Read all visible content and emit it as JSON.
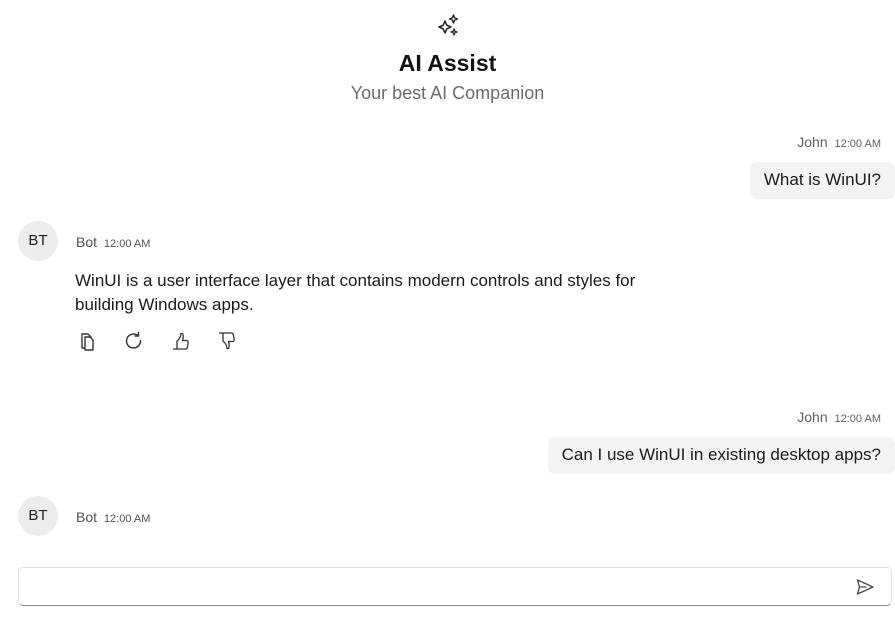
{
  "header": {
    "icon": "sparkle-icon",
    "title": "AI Assist",
    "subtitle": "Your best AI Companion"
  },
  "messages": [
    {
      "role": "user",
      "author": "John",
      "time": "12:00 AM",
      "text": "What is WinUI?"
    },
    {
      "role": "bot",
      "avatar": "BT",
      "author": "Bot",
      "time": "12:00 AM",
      "text": "WinUI is a user interface layer that contains modern controls and styles for building Windows apps.",
      "actions": [
        "copy-icon",
        "regenerate-icon",
        "thumbs-up-icon",
        "thumbs-down-icon"
      ]
    },
    {
      "role": "user",
      "author": "John",
      "time": "12:00 AM",
      "text": "Can I use WinUI in existing desktop apps?"
    },
    {
      "role": "bot",
      "avatar": "BT",
      "author": "Bot",
      "time": "12:00 AM",
      "text": ""
    }
  ],
  "composer": {
    "value": "",
    "placeholder": "",
    "send_icon": "send-icon"
  },
  "colors": {
    "bubble": "#f3f3f3",
    "avatar": "#ececec",
    "subtitle": "#6b6b6b"
  }
}
